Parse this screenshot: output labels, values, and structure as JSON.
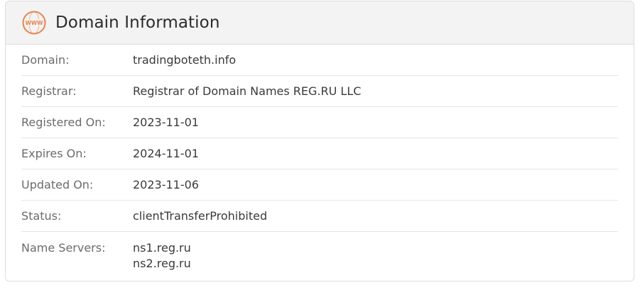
{
  "header": {
    "icon": "www-globe-icon",
    "icon_text": "WWW",
    "title": "Domain Information",
    "accent_color": "#e8834a"
  },
  "rows": {
    "domain": {
      "label": "Domain:",
      "value": "tradingboteth.info"
    },
    "registrar": {
      "label": "Registrar:",
      "value": "Registrar of Domain Names REG.RU LLC"
    },
    "registered_on": {
      "label": "Registered On:",
      "value": "2023-11-01"
    },
    "expires_on": {
      "label": "Expires On:",
      "value": "2024-11-01"
    },
    "updated_on": {
      "label": "Updated On:",
      "value": "2023-11-06"
    },
    "status": {
      "label": "Status:",
      "value": "clientTransferProhibited"
    },
    "name_servers": {
      "label": "Name Servers:",
      "values": [
        "ns1.reg.ru",
        "ns2.reg.ru"
      ]
    }
  }
}
